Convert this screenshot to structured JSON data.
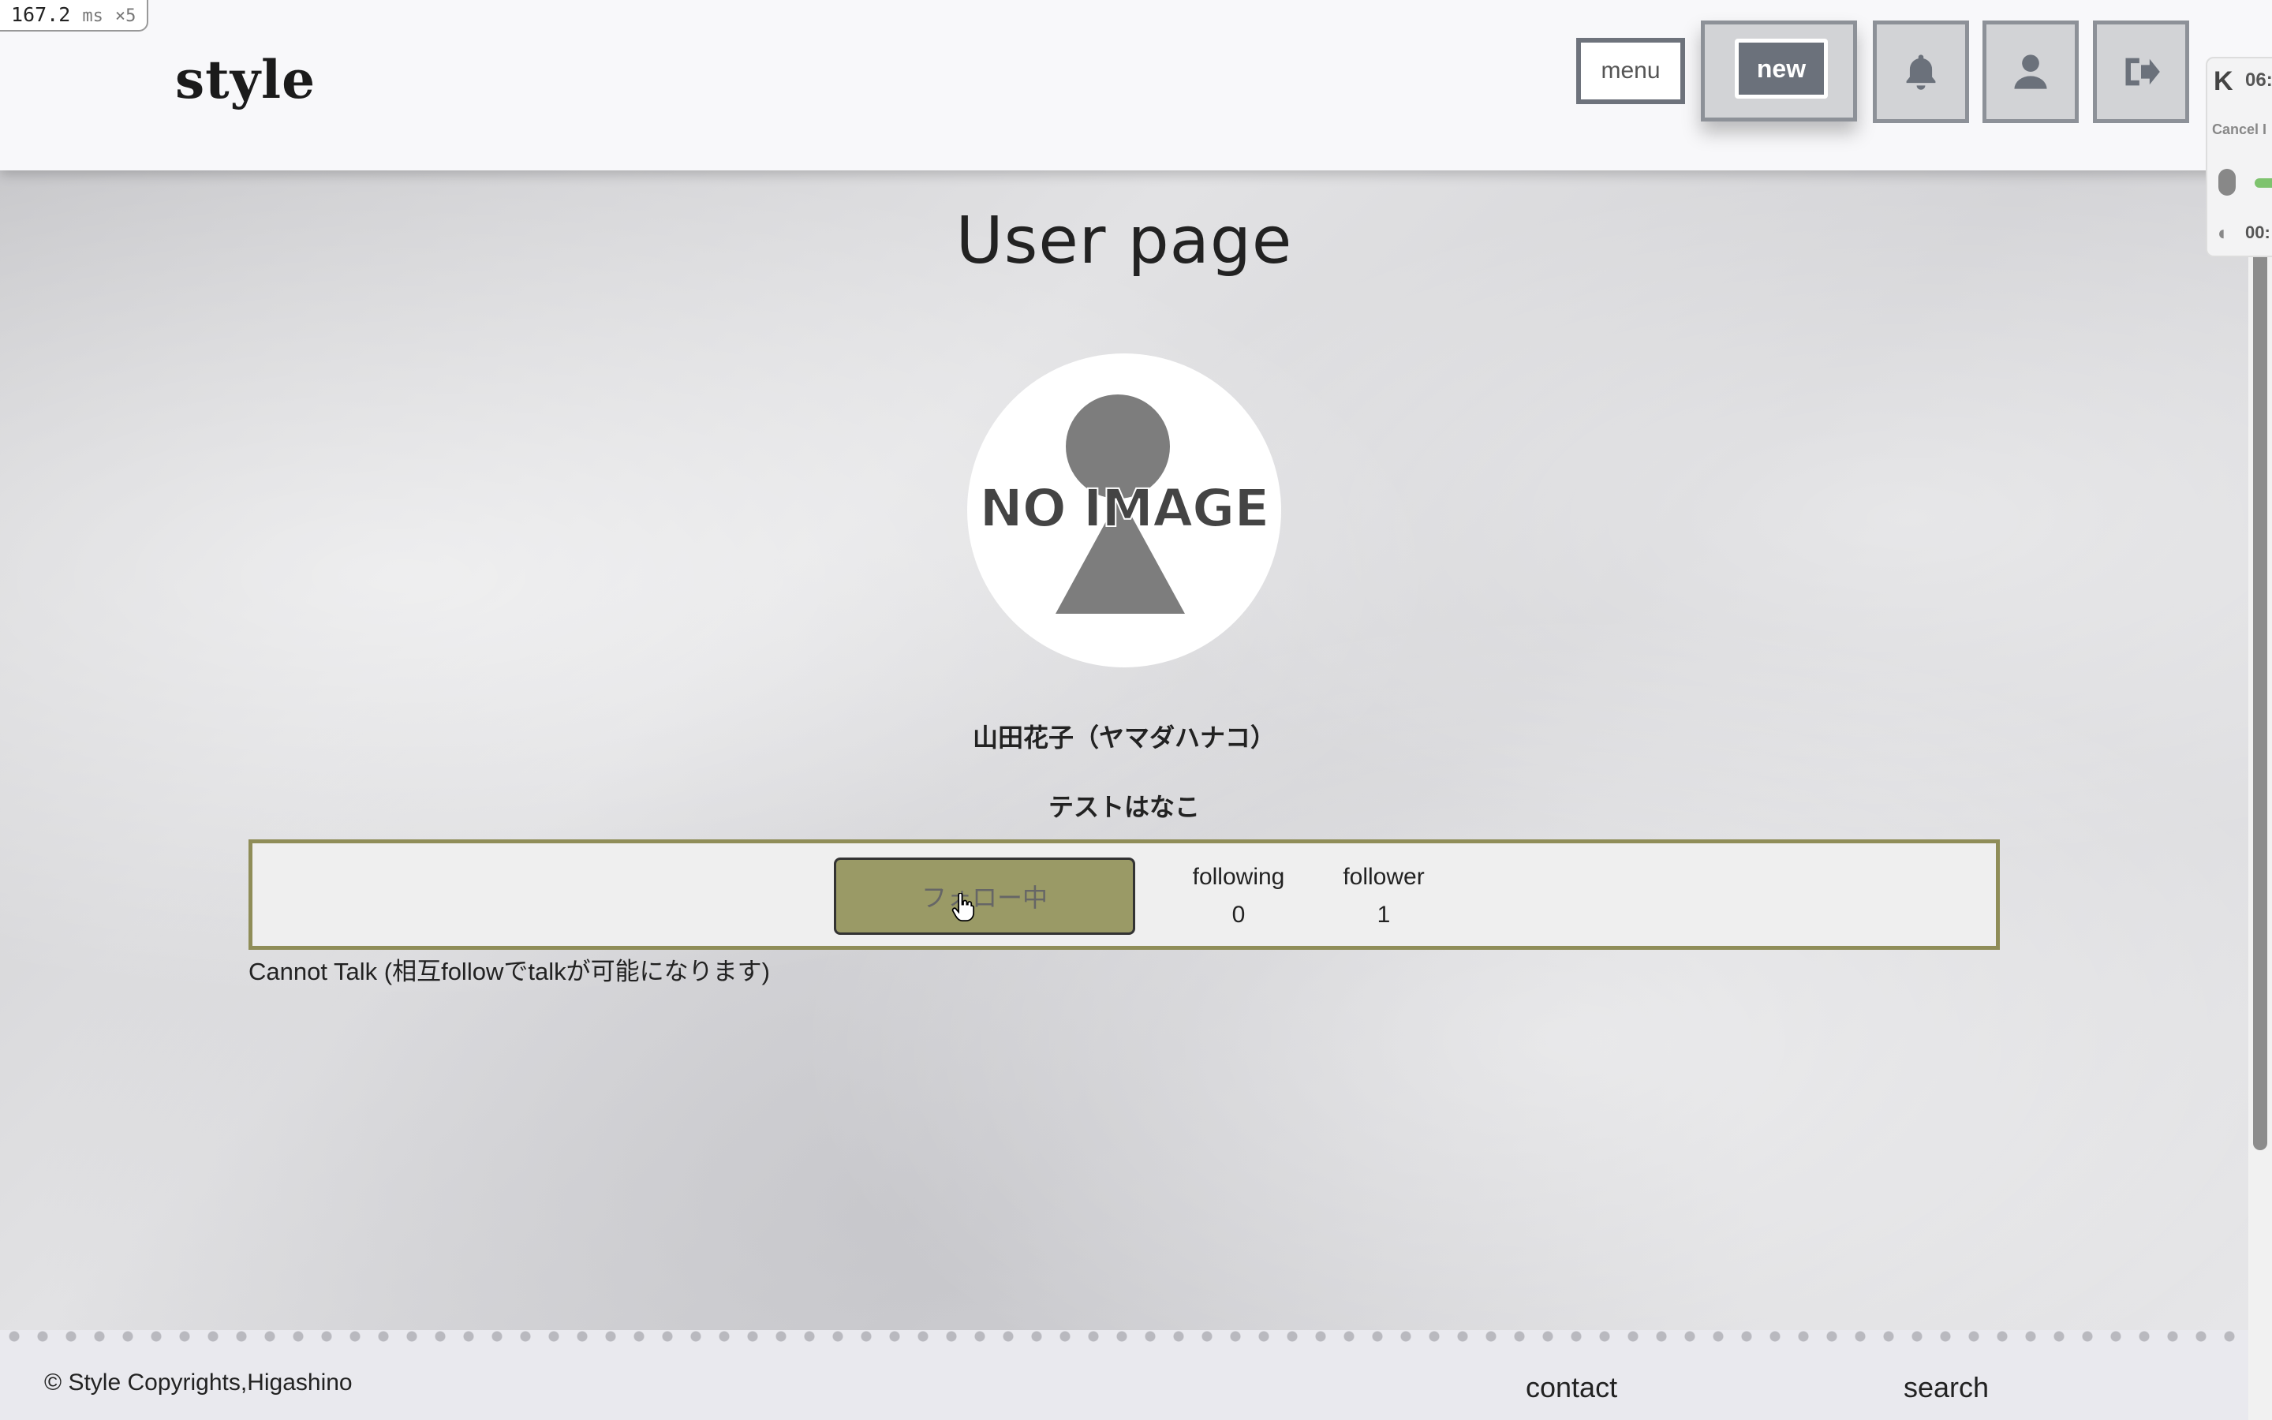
{
  "perf": {
    "value": "167.2",
    "unit": "ms",
    "multiplier": "×5"
  },
  "header": {
    "logo": "style",
    "menu_label": "menu",
    "new_label": "new",
    "icons": [
      "bell-icon",
      "user-icon",
      "logout-icon"
    ]
  },
  "side_widget": {
    "logo": "K",
    "time": "06:",
    "cancel": "Cancel I",
    "time2": "00:"
  },
  "main": {
    "title": "User page",
    "avatar_text": "NO IMAGE",
    "name": "山田花子（ヤマダハナコ）",
    "nickname": "テストはなこ",
    "follow_button": "フォロー中",
    "following_label": "following",
    "following_count": "0",
    "follower_label": "follower",
    "follower_count": "1",
    "talk_note": "Cannot Talk (相互followでtalkが可能になります)"
  },
  "footer": {
    "copyright": "© Style Copyrights,Higashino",
    "contact": "contact",
    "search": "search"
  },
  "colors": {
    "accent_olive": "#9a9a66",
    "border_olive": "#8f8d58",
    "button_gray": "#6b717b"
  }
}
